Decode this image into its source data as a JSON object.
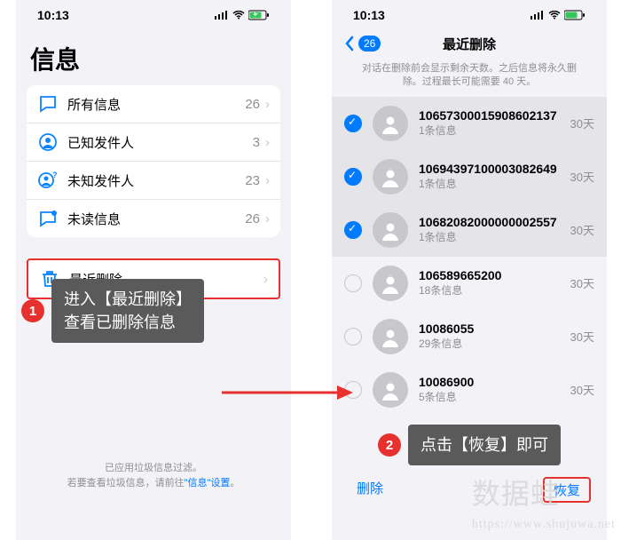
{
  "status": {
    "time": "10:13"
  },
  "left": {
    "title": "信息",
    "rows": [
      {
        "label": "所有信息",
        "count": "26"
      },
      {
        "label": "已知发件人",
        "count": "3"
      },
      {
        "label": "未知发件人",
        "count": "23"
      },
      {
        "label": "未读信息",
        "count": "26"
      }
    ],
    "trash": {
      "label": "最近删除"
    },
    "hint_line1": "已应用垃圾信息过滤。",
    "hint_line2a": "若要查看垃圾信息，请前往",
    "hint_link": "\"信息\"设置",
    "hint_line2b": "。"
  },
  "right": {
    "back_count": "26",
    "title": "最近删除",
    "sub_hint": "对话在删除前会显示剩余天数。之后信息将永久删除。过程最长可能需要 40 天。",
    "items": [
      {
        "title": "10657300015908602137",
        "sub": "1条信息",
        "days": "30天",
        "selected": true
      },
      {
        "title": "10694397100003082649",
        "sub": "1条信息",
        "days": "30天",
        "selected": true
      },
      {
        "title": "10682082000000002557",
        "sub": "1条信息",
        "days": "30天",
        "selected": true
      },
      {
        "title": "106589665200",
        "sub": "18条信息",
        "days": "30天",
        "selected": false
      },
      {
        "title": "10086055",
        "sub": "29条信息",
        "days": "30天",
        "selected": false
      },
      {
        "title": "10086900",
        "sub": "5条信息",
        "days": "30天",
        "selected": false
      }
    ],
    "toolbar": {
      "delete": "删除",
      "recover": "恢复"
    }
  },
  "callouts": {
    "c1": "进入【最近删除】\n查看已删除信息",
    "c2": "点击【恢复】即可"
  },
  "watermark": {
    "big": "数据蛙",
    "url": "https://www.shujuwa.net"
  }
}
